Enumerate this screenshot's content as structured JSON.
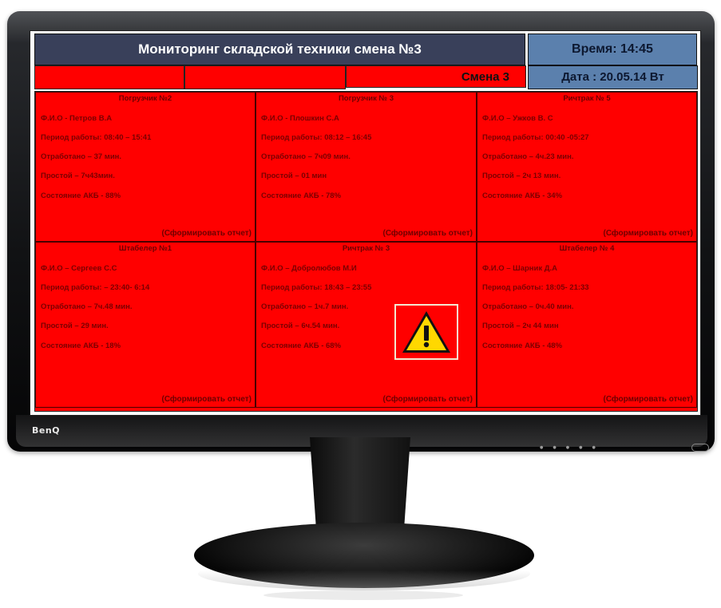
{
  "brand": "BenQ",
  "screen": {
    "header": {
      "title": "Мониторинг  складской техники смена №3",
      "time": "Время:  14:45",
      "shift": "Смена 3",
      "date": "Дата : 20.05.14   Вт"
    },
    "colors": {
      "header_bg": "#39405a",
      "info_bg": "#5b80ad",
      "alert_bg": "#ff0000"
    },
    "panels": [
      {
        "title": "Погрузчик №2",
        "operator": "Ф.И.О - Петров В.А",
        "period": "Период работы:  08:40 – 15:41",
        "worked": "Отработано – 37 мин.",
        "idle": "Простой – 7ч43мин.",
        "battery": "Состояние АКБ - 88%",
        "report": "(Сформировать отчет)"
      },
      {
        "title": "Погрузчик № 3",
        "operator": "Ф.И.О - Плошкин С.А",
        "period": "Период работы:  08:12 – 16:45",
        "worked": "Отработано – 7ч09 мин.",
        "idle": "Простой – 01 мин",
        "battery": "Состояние АКБ - 78%",
        "report": "(Сформировать  отчет)"
      },
      {
        "title": "Ричтрак № 5",
        "operator": "Ф.И.О – Ужков В. С",
        "period": "Период работы:  00:40 -05:27",
        "worked": "Отработано – 4ч.23 мин.",
        "idle": "Простой – 2ч 13 мин.",
        "battery": "Состояние АКБ - 34%",
        "report": "(Сформировать  отчет)"
      },
      {
        "title": "Штабелер №1",
        "operator": "Ф.И.О – Сергеев С.С",
        "period": "Период работы:  – 23:40- 6:14",
        "worked": "Отработано – 7ч.48 мин.",
        "idle": "Простой – 29 мин.",
        "battery": "Состояние АКБ - 18%",
        "report": "(Сформировать  отчет)"
      },
      {
        "title": "Ричтрак № 3",
        "operator": "Ф.И.О – Добролюбов  М.И",
        "period": "Период работы:  18:43 – 23:55",
        "worked": "Отработано – 1ч.7 мин.",
        "idle": "Простой – 6ч.54 мин.",
        "battery": "Состояние АКБ - 68%",
        "report": "(Сформировать  отчет)",
        "warning_icon": "warning-triangle-icon"
      },
      {
        "title": "Штабелер № 4",
        "operator": "Ф.И.О – Шарник Д.А",
        "period": "Период работы:  18:05- 21:33",
        "worked": "Отработано – 0ч.40 мин.",
        "idle": "Простой – 2ч 44 мин",
        "battery": "Состояние АКБ - 48%",
        "report": "(Сформировать  отчет)"
      }
    ]
  }
}
